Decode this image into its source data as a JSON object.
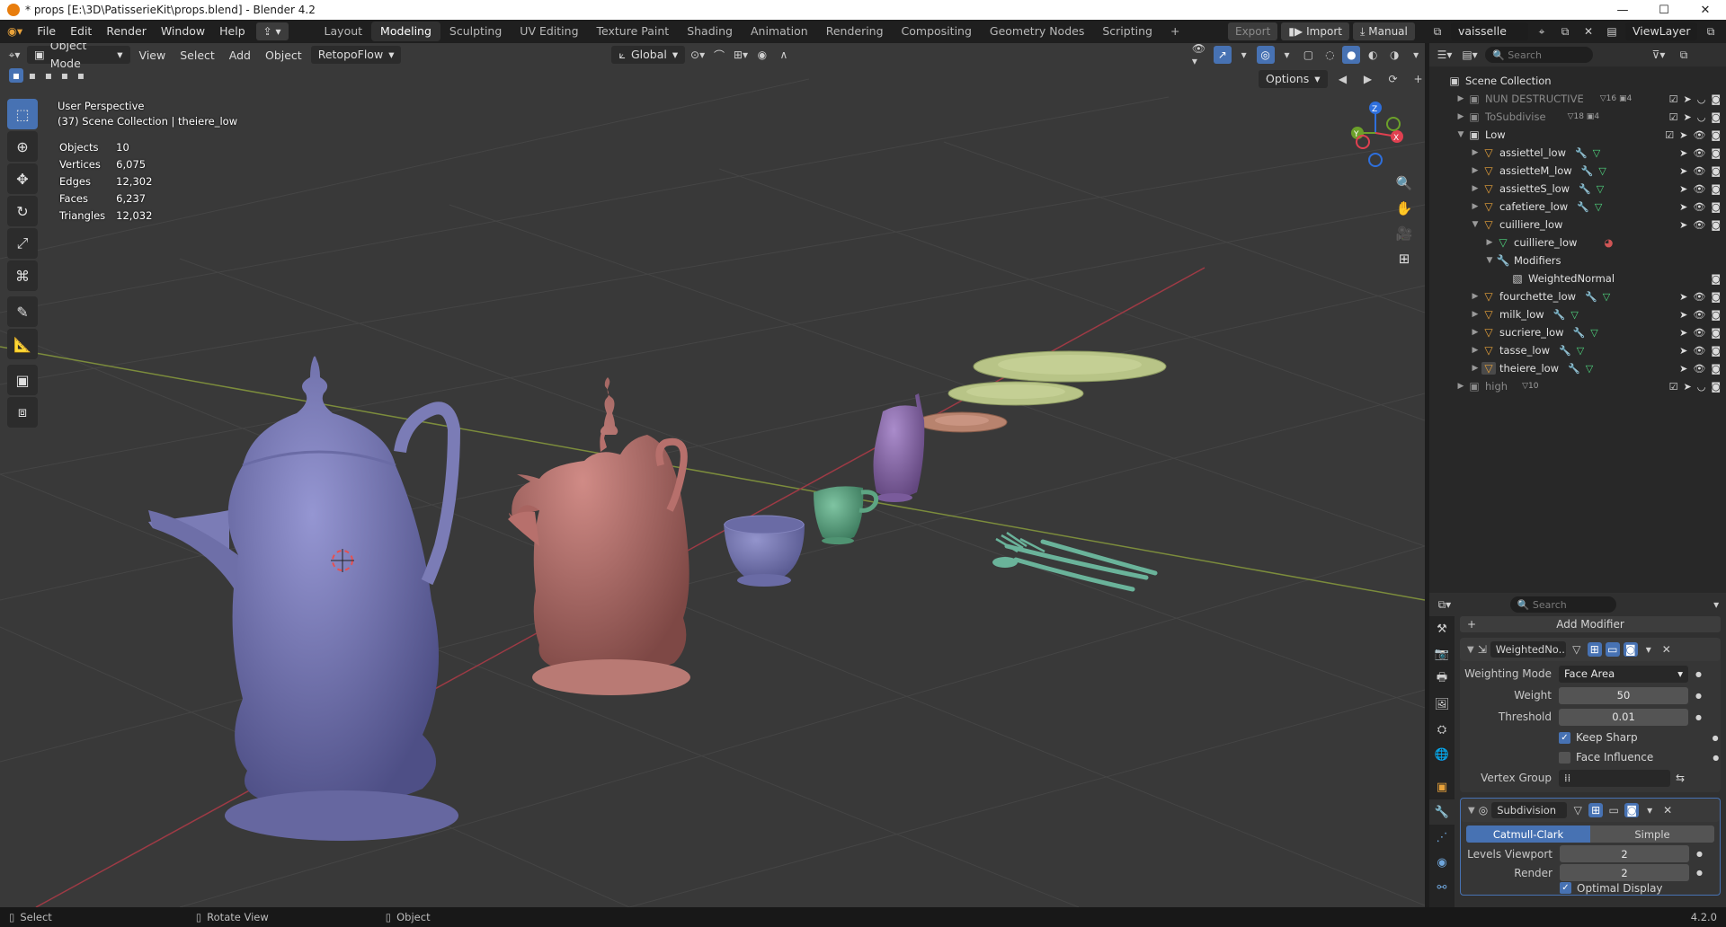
{
  "window": {
    "title": "* props [E:\\3D\\PatisserieKit\\props.blend] - Blender 4.2",
    "controls": [
      "minimize",
      "maximize",
      "close"
    ]
  },
  "topbar": {
    "menus": [
      "File",
      "Edit",
      "Render",
      "Window",
      "Help"
    ],
    "workspaces": [
      "Layout",
      "Modeling",
      "Sculpting",
      "UV Editing",
      "Texture Paint",
      "Shading",
      "Animation",
      "Rendering",
      "Compositing",
      "Geometry Nodes",
      "Scripting"
    ],
    "active_workspace": "Modeling",
    "export_label": "Export",
    "import_label": "Import",
    "manual_label": "Manual",
    "scene_name": "vaisselle",
    "view_layer": "ViewLayer"
  },
  "viewport": {
    "mode": "Object Mode",
    "menus": [
      "View",
      "Select",
      "Add",
      "Object"
    ],
    "addon_menu": "RetopoFlow",
    "orientation": "Global",
    "options_label": "Options",
    "perspective": "User Perspective",
    "collection_info": "(37) Scene Collection | theiere_low",
    "stats": [
      {
        "label": "Objects",
        "value": "10"
      },
      {
        "label": "Vertices",
        "value": "6,075"
      },
      {
        "label": "Edges",
        "value": "12,302"
      },
      {
        "label": "Faces",
        "value": "6,237"
      },
      {
        "label": "Triangles",
        "value": "12,032"
      }
    ],
    "gizmo_axes": [
      "X",
      "Y",
      "Z"
    ]
  },
  "outliner": {
    "search_placeholder": "Search",
    "root": "Scene Collection",
    "rows": [
      {
        "label": "NUN DESTRUCTIVE",
        "badge1": "16",
        "badge2": "4",
        "kind": "collection",
        "dim": true
      },
      {
        "label": "ToSubdivise",
        "badge1": "18",
        "badge2": "4",
        "kind": "collection",
        "dim": true
      },
      {
        "label": "Low",
        "kind": "collection",
        "dim": false
      },
      {
        "label": "assiettel_low",
        "kind": "object"
      },
      {
        "label": "assietteM_low",
        "kind": "object"
      },
      {
        "label": "assietteS_low",
        "kind": "object"
      },
      {
        "label": "cafetiere_low",
        "kind": "object"
      },
      {
        "label": "cuilliere_low",
        "kind": "object"
      },
      {
        "label": "cuilliere_low",
        "kind": "mesh"
      },
      {
        "label": "Modifiers",
        "kind": "modifiers"
      },
      {
        "label": "WeightedNormal",
        "kind": "modifier"
      },
      {
        "label": "fourchette_low",
        "kind": "object"
      },
      {
        "label": "milk_low",
        "kind": "object"
      },
      {
        "label": "sucriere_low",
        "kind": "object"
      },
      {
        "label": "tasse_low",
        "kind": "object"
      },
      {
        "label": "theiere_low",
        "kind": "object"
      },
      {
        "label": "high",
        "badge1": "10",
        "kind": "collection",
        "dim": true
      }
    ]
  },
  "properties": {
    "search_placeholder": "Search",
    "add_modifier": "Add Modifier",
    "weighted": {
      "name": "WeightedNo...",
      "weighting_mode_label": "Weighting Mode",
      "weighting_mode": "Face Area",
      "weight_label": "Weight",
      "weight": "50",
      "threshold_label": "Threshold",
      "threshold": "0.01",
      "keep_sharp": "Keep Sharp",
      "face_influence": "Face Influence",
      "vertex_group_label": "Vertex Group"
    },
    "subdivision": {
      "name": "Subdivision",
      "tab_catmull": "Catmull-Clark",
      "tab_simple": "Simple",
      "levels_viewport_label": "Levels Viewport",
      "levels_viewport": "2",
      "render_label": "Render",
      "render": "2",
      "optimal_display": "Optimal Display"
    }
  },
  "statusbar": {
    "select": "Select",
    "rotate": "Rotate View",
    "object": "Object",
    "version": "4.2.0"
  },
  "colors": {
    "accent": "#4772b3",
    "viewport_bg": "#393939",
    "teapot_big": "#7b7cb6",
    "teapot_small": "#b7706c",
    "sugar_bowl": "#7879b6",
    "cup": "#5da583",
    "milk_jug": "#8f6fb0",
    "plates": "#b8c487",
    "saucer": "#b8836e",
    "cutlery": "#6ab39a"
  }
}
